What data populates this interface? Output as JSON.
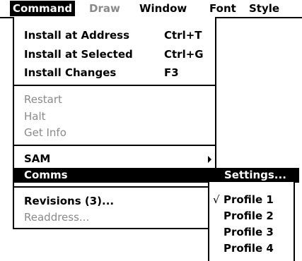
{
  "menubar": {
    "items": [
      {
        "label": "Command",
        "state": "active"
      },
      {
        "label": "Draw",
        "state": "disabled"
      },
      {
        "label": "Window",
        "state": "normal"
      },
      {
        "label": "Font",
        "state": "normal"
      },
      {
        "label": "Style",
        "state": "normal"
      }
    ]
  },
  "command_menu": {
    "items": [
      {
        "label": "Install at Address",
        "accelerator": "Ctrl+T"
      },
      {
        "label": "Install at Selected",
        "accelerator": "Ctrl+G"
      },
      {
        "label": "Install Changes",
        "accelerator": "F3"
      },
      {
        "label": "Restart"
      },
      {
        "label": "Halt"
      },
      {
        "label": "Get Info"
      },
      {
        "label": "SAM"
      },
      {
        "label": "Comms"
      },
      {
        "label": "Revisions (3)..."
      },
      {
        "label": "Readdress..."
      }
    ]
  },
  "comms_submenu": {
    "settings_label": "Settings...",
    "check_glyph": "√",
    "profiles": [
      "Profile 1",
      "Profile 2",
      "Profile 3",
      "Profile 4"
    ]
  },
  "colors": {
    "highlight": "#000000",
    "disabled_text": "#8a8a8a",
    "background": "#ffffff"
  }
}
